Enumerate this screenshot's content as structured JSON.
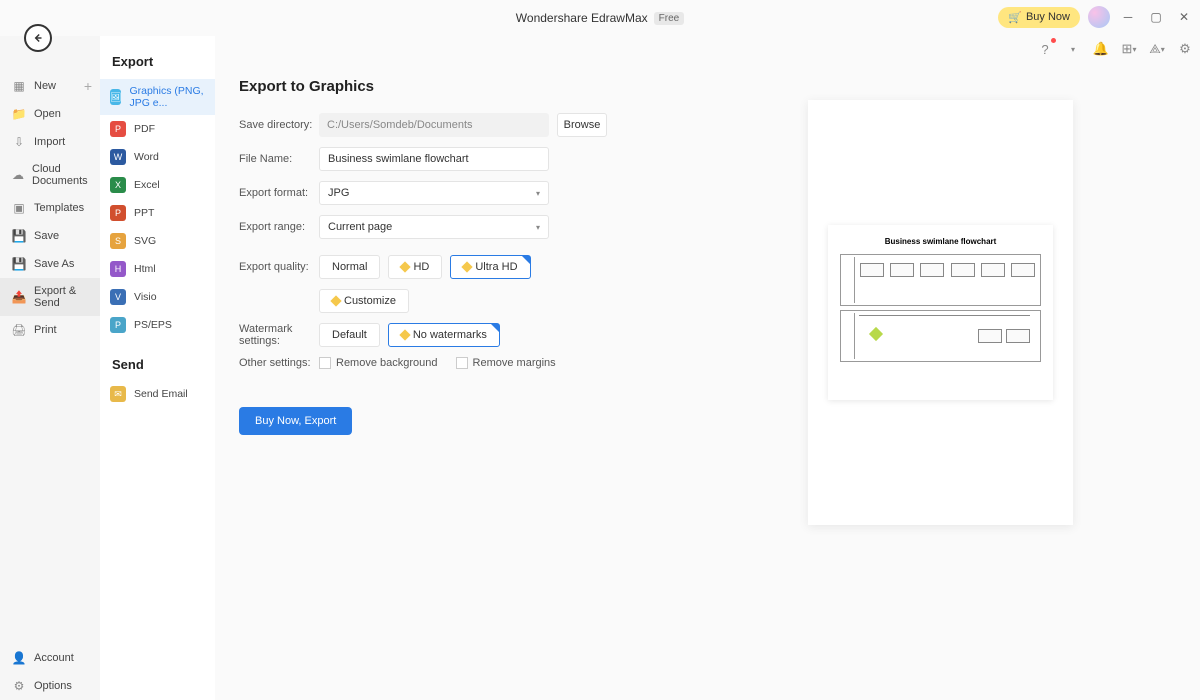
{
  "titlebar": {
    "app_name": "Wondershare EdrawMax",
    "badge": "Free",
    "buy_label": "Buy Now"
  },
  "left_sidebar": {
    "items": [
      {
        "label": "New",
        "icon": "plus-square"
      },
      {
        "label": "Open",
        "icon": "folder"
      },
      {
        "label": "Import",
        "icon": "import"
      },
      {
        "label": "Cloud Documents",
        "icon": "cloud"
      },
      {
        "label": "Templates",
        "icon": "template"
      },
      {
        "label": "Save",
        "icon": "save"
      },
      {
        "label": "Save As",
        "icon": "save-as"
      },
      {
        "label": "Export & Send",
        "icon": "export"
      },
      {
        "label": "Print",
        "icon": "print"
      }
    ],
    "footer": [
      {
        "label": "Account",
        "icon": "user"
      },
      {
        "label": "Options",
        "icon": "gear"
      }
    ]
  },
  "format_panel": {
    "export_header": "Export",
    "send_header": "Send",
    "formats": [
      {
        "label": "Graphics (PNG, JPG e...",
        "color": "#48b7e8"
      },
      {
        "label": "PDF",
        "color": "#e54d42"
      },
      {
        "label": "Word",
        "color": "#2c5aa0"
      },
      {
        "label": "Excel",
        "color": "#2a8c4a"
      },
      {
        "label": "PPT",
        "color": "#d14f2e"
      },
      {
        "label": "SVG",
        "color": "#e6a33e"
      },
      {
        "label": "Html",
        "color": "#9458c9"
      },
      {
        "label": "Visio",
        "color": "#3a6fb5"
      },
      {
        "label": "PS/EPS",
        "color": "#4aa5c9"
      }
    ],
    "send_items": [
      {
        "label": "Send Email",
        "color": "#e8b94a"
      }
    ]
  },
  "main": {
    "title": "Export to Graphics",
    "save_dir_label": "Save directory:",
    "save_dir_value": "C:/Users/Somdeb/Documents",
    "browse_label": "Browse",
    "filename_label": "File Name:",
    "filename_value": "Business swimlane flowchart",
    "format_label": "Export format:",
    "format_value": "JPG",
    "range_label": "Export range:",
    "range_value": "Current page",
    "quality_label": "Export quality:",
    "quality_options": [
      "Normal",
      "HD",
      "Ultra HD"
    ],
    "customize_label": "Customize",
    "watermark_label": "Watermark settings:",
    "watermark_options": [
      "Default",
      "No watermarks"
    ],
    "other_label": "Other settings:",
    "remove_bg_label": "Remove background",
    "remove_margin_label": "Remove margins",
    "export_btn": "Buy Now, Export"
  },
  "preview": {
    "title": "Business swimlane flowchart"
  }
}
